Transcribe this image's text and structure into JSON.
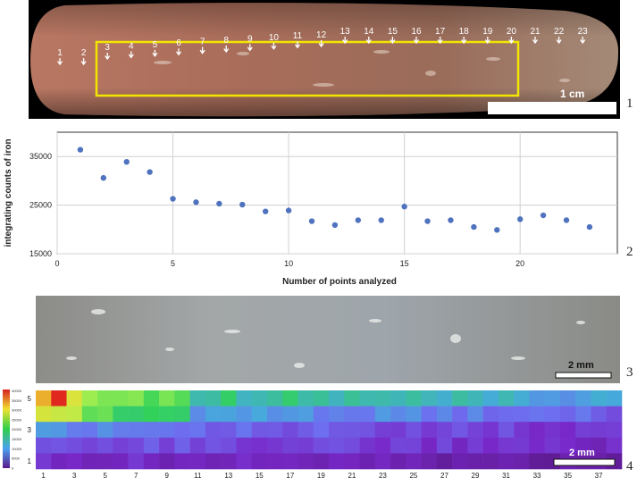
{
  "panels": [
    {
      "id": "1",
      "label": "1"
    },
    {
      "id": "2",
      "label": "2"
    },
    {
      "id": "3",
      "label": "3"
    },
    {
      "id": "4",
      "label": "4"
    }
  ],
  "photo1": {
    "scale_label": "1 cm",
    "points": [
      "1",
      "2",
      "3",
      "4",
      "5",
      "6",
      "7",
      "8",
      "9",
      "10",
      "11",
      "12",
      "13",
      "14",
      "15",
      "16",
      "17",
      "18",
      "19",
      "20",
      "21",
      "22",
      "23"
    ]
  },
  "chart_data": {
    "type": "scatter",
    "xlabel": "Number of points analyzed",
    "ylabel": "integrating counts of iron",
    "xlim": [
      0,
      23
    ],
    "ylim": [
      15000,
      40000
    ],
    "xticks": [
      0,
      5,
      10,
      15,
      20
    ],
    "yticks": [
      15000,
      25000,
      35000
    ],
    "ytick_labels": [
      "15000",
      "25000",
      "35000"
    ],
    "grid": true,
    "point_color": "#4f73be",
    "x": [
      1,
      2,
      3,
      4,
      5,
      6,
      7,
      8,
      9,
      10,
      11,
      12,
      13,
      14,
      15,
      16,
      17,
      18,
      19,
      20,
      21,
      22,
      23
    ],
    "y": [
      36400,
      30600,
      33900,
      31800,
      26300,
      25600,
      25300,
      25100,
      23700,
      23900,
      21700,
      20900,
      21900,
      21900,
      24700,
      21700,
      21900,
      20500,
      19900,
      22100,
      22900,
      21900,
      20500
    ]
  },
  "photo3": {
    "scale_label": "2 mm"
  },
  "heatmap": {
    "scale_label": "2 mm",
    "colorbar_labels": [
      "40000",
      "35000",
      "30000",
      "25000",
      "20000",
      "15000",
      "10000",
      "5000",
      "0"
    ],
    "row_labels": [
      "5",
      "",
      "3",
      "",
      "1"
    ],
    "col_labels": [
      "1",
      "3",
      "5",
      "7",
      "9",
      "11",
      "13",
      "15",
      "17",
      "19",
      "21",
      "23",
      "25",
      "27",
      "29",
      "31",
      "33",
      "35",
      "37"
    ]
  }
}
